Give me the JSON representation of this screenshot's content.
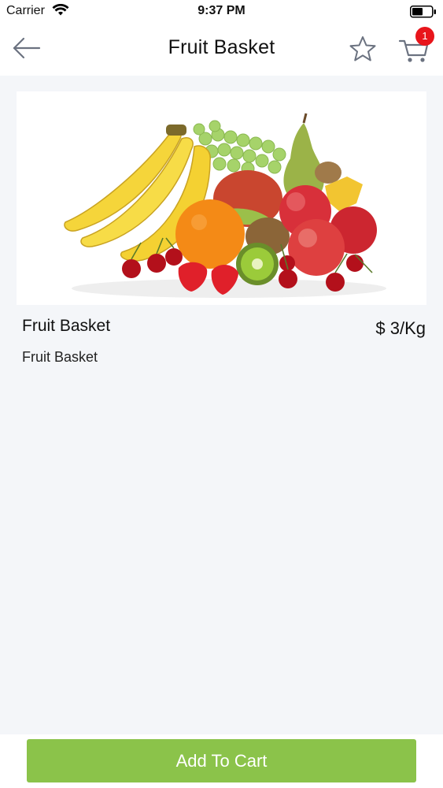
{
  "status_bar": {
    "carrier": "Carrier",
    "time": "9:37 PM"
  },
  "nav": {
    "title": "Fruit Basket",
    "cart_count": "1"
  },
  "product": {
    "name": "Fruit Basket",
    "price": "$ 3/Kg",
    "description": "Fruit Basket"
  },
  "actions": {
    "add_to_cart": "Add To Cart"
  },
  "colors": {
    "accent_button": "#8bc34a",
    "badge": "#e8151b",
    "background": "#f4f6f9"
  },
  "icons": {
    "back": "arrow-left-icon",
    "favorite": "star-outline-icon",
    "cart": "shopping-cart-icon",
    "wifi": "wifi-icon",
    "battery": "battery-icon"
  }
}
